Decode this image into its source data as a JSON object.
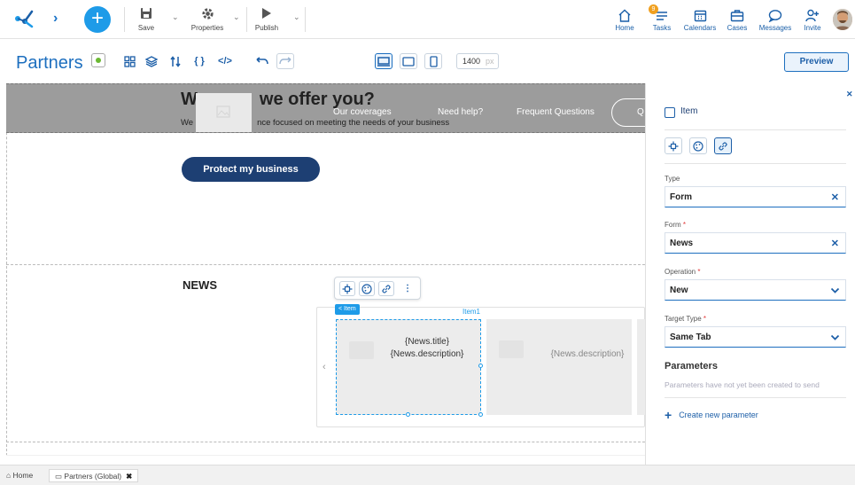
{
  "toolbar": {
    "save_label": "Save",
    "properties_label": "Properties",
    "publish_label": "Publish"
  },
  "nav": {
    "home": "Home",
    "tasks": "Tasks",
    "tasks_badge": "9",
    "calendars": "Calendars",
    "cases": "Cases",
    "messages": "Messages",
    "invite": "Invite"
  },
  "subbar": {
    "title": "Partners",
    "width_value": "1400",
    "width_unit": "px",
    "preview_label": "Preview"
  },
  "canvas": {
    "hero_title_part1": "W",
    "hero_title_part2": "we offer you?",
    "hero_sub_part1": "We",
    "hero_sub_part2": "nce focused on meeting the needs of your business",
    "nav_coverages": "Our coverages",
    "nav_help": "Need help?",
    "nav_faq": "Frequent Questions",
    "nav_oval": "Q",
    "protect_button": "Protect my business",
    "news_title": "NEWS",
    "item_tag": "< Item",
    "item1_label": "Item1",
    "card1_title": "{News.title}",
    "card1_desc": "{News.description}",
    "card2_desc": "{News.description}"
  },
  "panel": {
    "item_label": "Item",
    "type_label": "Type",
    "type_value": "Form",
    "form_label": "Form",
    "form_value": "News",
    "operation_label": "Operation",
    "operation_value": "New",
    "target_label": "Target Type",
    "target_value": "Same Tab",
    "params_title": "Parameters",
    "params_empty": "Parameters have not yet been created to send",
    "create_param": "Create new parameter"
  },
  "bottom_tabs": {
    "home": "Home",
    "partners": "Partners (Global)"
  },
  "colors": {
    "accent": "#1d6fbf",
    "primary_button": "#1d3f73",
    "hero_bg": "#9c9c9c",
    "item_selection": "#1e9be8",
    "badge": "#f0a020",
    "status_green": "#6bb832"
  }
}
